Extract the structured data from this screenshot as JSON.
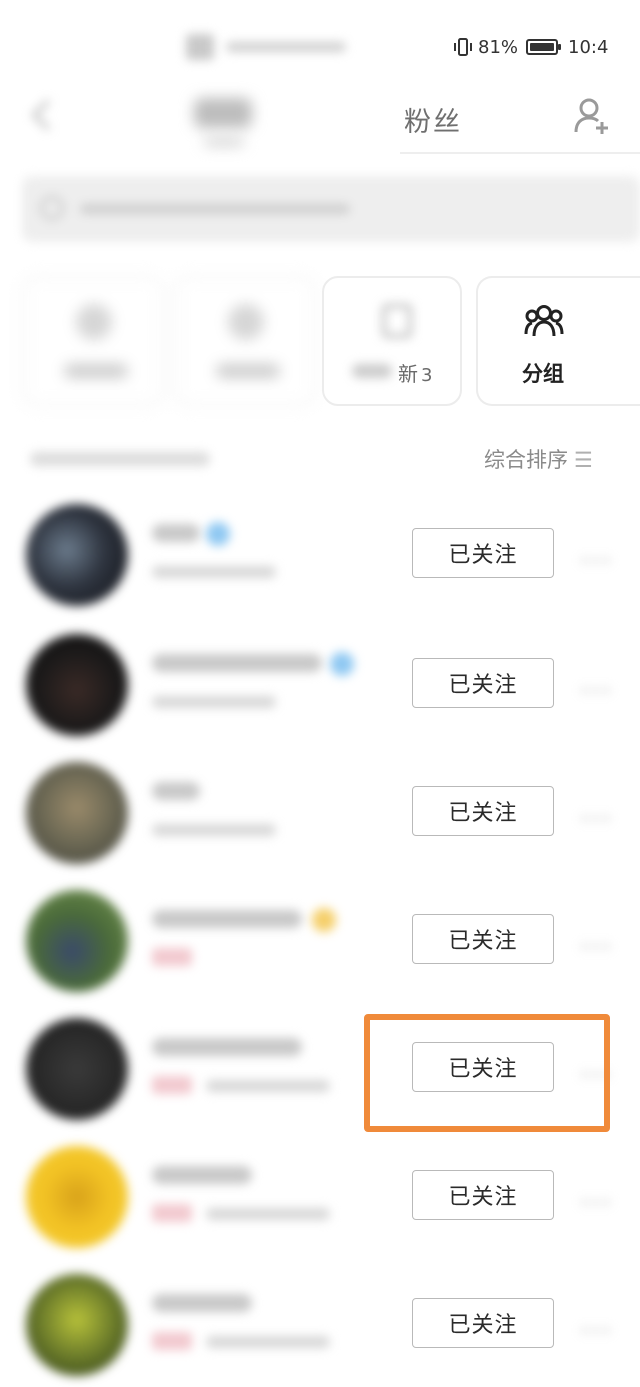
{
  "status_bar": {
    "battery_percent": "81%",
    "clock": "10:4",
    "vibrate_icon": "vibrate-icon",
    "battery_icon": "battery-icon"
  },
  "nav": {
    "active_tab": "粉丝",
    "back_icon": "back-arrow-icon",
    "add_friend_icon": "add-user-icon"
  },
  "quick_cards": [
    {
      "label_visible": "新",
      "count": "3",
      "icon": "gift-icon"
    },
    {
      "label": "分组",
      "icon": "group-icon"
    }
  ],
  "list_header": {
    "sort_label": "综合排序",
    "sort_icon": "sort-icon"
  },
  "rows": [
    {
      "button": "已关注"
    },
    {
      "button": "已关注"
    },
    {
      "button": "已关注"
    },
    {
      "button": "已关注"
    },
    {
      "button": "已关注"
    },
    {
      "button": "已关注"
    },
    {
      "button": "已关注"
    }
  ],
  "colors": {
    "highlight": "#f08a3a",
    "button_border": "#b9b9b9",
    "muted_text": "#8a8a8a"
  }
}
